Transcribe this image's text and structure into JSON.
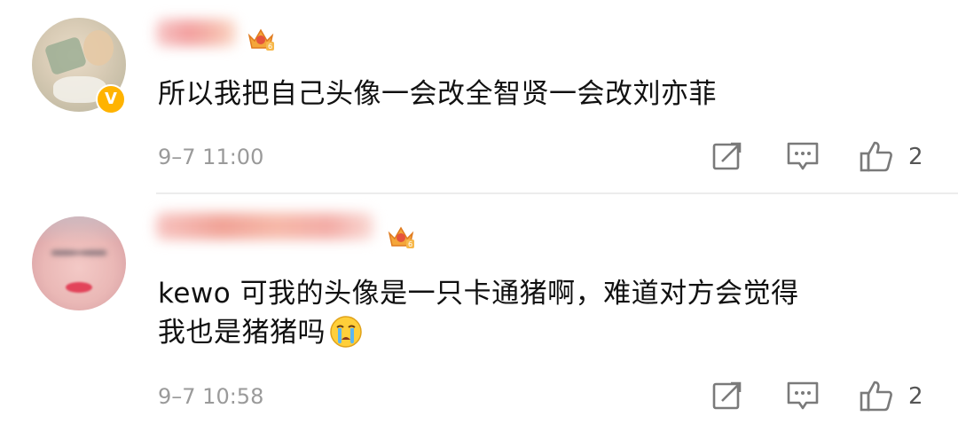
{
  "comments": [
    {
      "avatar_icon": "blurred-photo-avatar",
      "verified_badge": "V",
      "vip_icon": "vip-crown-icon",
      "text_lines": [
        "所以我把自己头像一会改全智贤一会改刘亦菲"
      ],
      "time": "9–7 11:00",
      "likes": "2"
    },
    {
      "avatar_icon": "blurred-face-avatar",
      "vip_icon": "vip-crown-icon",
      "text_lines": [
        "kewo 可我的头像是一只卡通猪啊，难道对方会觉得",
        "我也是猪猪吗"
      ],
      "emoji": "crying-face-emoji",
      "time": "9–7 10:58",
      "likes": "2"
    }
  ],
  "icons": {
    "repost": "repost-icon",
    "reply": "comment-icon",
    "like": "thumbs-up-icon"
  },
  "colors": {
    "text": "#111111",
    "meta": "#9a9a9a",
    "icon": "#7a7a7a",
    "badge": "#ffb300",
    "divider": "#ececec"
  }
}
